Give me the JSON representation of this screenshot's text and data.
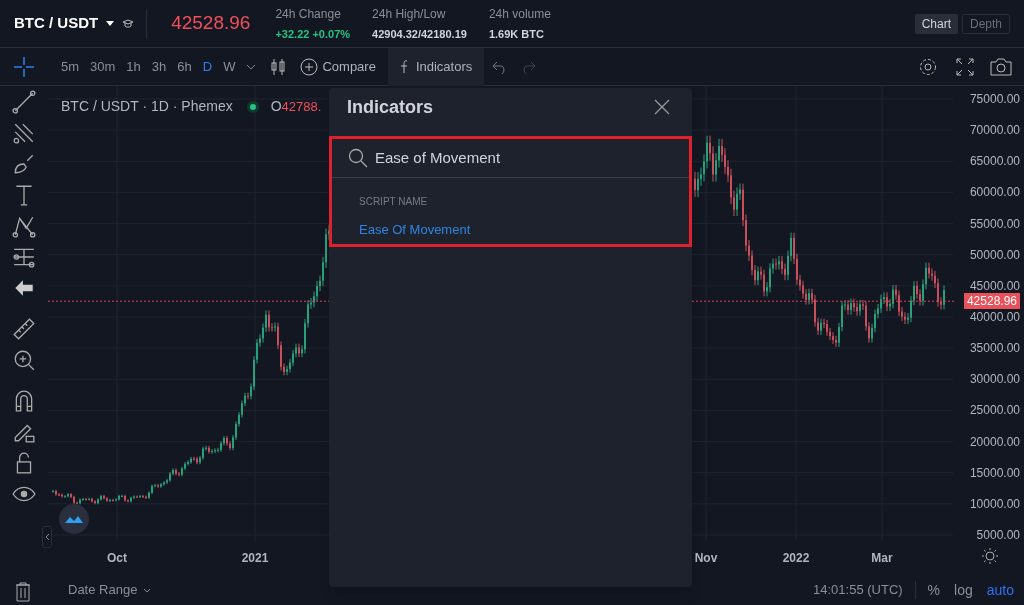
{
  "header": {
    "pair": "BTC / USDT",
    "price": "42528.96",
    "stats": [
      {
        "label": "24h Change",
        "value": "+32.22 +0.07%",
        "kind": "up"
      },
      {
        "label": "24h High/Low",
        "value": "42904.32/42180.19",
        "kind": "plain"
      },
      {
        "label": "24h volume",
        "value": "1.69K BTC",
        "kind": "plain"
      }
    ],
    "view_tabs": [
      {
        "label": "Chart",
        "selected": true
      },
      {
        "label": "Depth",
        "selected": false
      }
    ]
  },
  "toolbar": {
    "intervals": [
      {
        "label": "5m",
        "selected": false
      },
      {
        "label": "30m",
        "selected": false
      },
      {
        "label": "1h",
        "selected": false
      },
      {
        "label": "3h",
        "selected": false
      },
      {
        "label": "6h",
        "selected": false
      },
      {
        "label": "D",
        "selected": true
      },
      {
        "label": "W",
        "selected": false
      }
    ],
    "compare": "Compare",
    "indicators": "Indicators"
  },
  "legend": {
    "symbol": "BTC / USDT · 1D · Phemex",
    "open_label": "O",
    "open_value": "42788."
  },
  "price_axis": [
    "75000.00",
    "70000.00",
    "65000.00",
    "60000.00",
    "55000.00",
    "50000.00",
    "45000.00",
    "40000.00",
    "35000.00",
    "30000.00",
    "25000.00",
    "20000.00",
    "15000.00",
    "10000.00",
    "5000.00"
  ],
  "last_price": "42528.96",
  "time_axis": [
    "Oct",
    "2021",
    "Nov",
    "2022",
    "Mar"
  ],
  "bottom_bar": {
    "date_range": "Date Range",
    "clock": "14:01:55 (UTC)",
    "scale_options": [
      {
        "label": "%",
        "selected": false
      },
      {
        "label": "log",
        "selected": false
      },
      {
        "label": "auto",
        "selected": true
      }
    ]
  },
  "dialog": {
    "title": "Indicators",
    "search": {
      "value": "Ease of Movement"
    },
    "section": "SCRIPT NAME",
    "results": [
      "Ease Of Movement"
    ]
  }
}
